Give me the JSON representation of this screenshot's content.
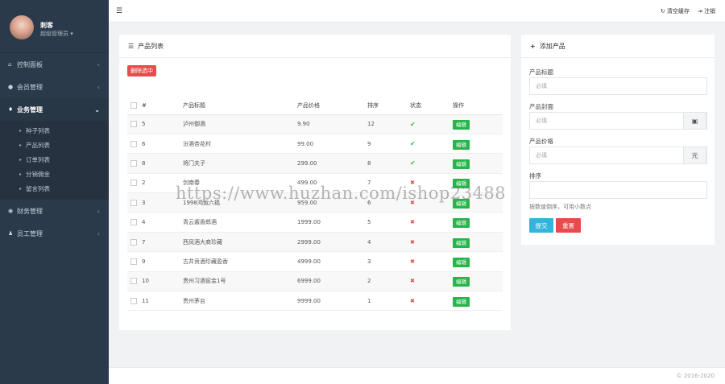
{
  "sidebar": {
    "user_name": "刺客",
    "user_role": "超级管理员",
    "menu": [
      {
        "label": "控制面板",
        "icon": "home-icon",
        "active": false
      },
      {
        "label": "会员管理",
        "icon": "user-icon",
        "active": false
      },
      {
        "label": "业务管理",
        "icon": "flame-icon",
        "active": true
      },
      {
        "label": "财务管理",
        "icon": "coins-icon",
        "active": false
      },
      {
        "label": "员工管理",
        "icon": "staff-icon",
        "active": false
      }
    ],
    "submenu": [
      "种子列表",
      "产品列表",
      "订单列表",
      "分销佣金",
      "留言列表"
    ]
  },
  "topbar": {
    "clear_cache": "清空缓存",
    "logout": "注销"
  },
  "product_panel": {
    "title": "产品列表",
    "delete_selected": "删除选中",
    "columns": [
      "#",
      "产品标题",
      "产品价格",
      "排序",
      "状态",
      "操作"
    ],
    "rows": [
      {
        "id": "5",
        "title": "泸州御酒",
        "price": "9.90",
        "sort": "12",
        "status": "on"
      },
      {
        "id": "6",
        "title": "汾酒杏花村",
        "price": "99.00",
        "sort": "9",
        "status": "on"
      },
      {
        "id": "8",
        "title": "将门夫子",
        "price": "299.00",
        "sort": "8",
        "status": "on"
      },
      {
        "id": "2",
        "title": "剑南春",
        "price": "499.00",
        "sort": "7",
        "status": "off"
      },
      {
        "id": "3",
        "title": "1998鸿运六福",
        "price": "959.00",
        "sort": "6",
        "status": "off"
      },
      {
        "id": "4",
        "title": "青云酱香郎酒",
        "price": "1999.00",
        "sort": "5",
        "status": "off"
      },
      {
        "id": "7",
        "title": "西凤酒大商珍藏",
        "price": "2999.00",
        "sort": "4",
        "status": "off"
      },
      {
        "id": "9",
        "title": "古井贡酒珍藏盈香",
        "price": "4999.00",
        "sort": "3",
        "status": "off"
      },
      {
        "id": "10",
        "title": "贵州习酒窖金1号",
        "price": "6999.00",
        "sort": "2",
        "status": "off"
      },
      {
        "id": "11",
        "title": "贵州茅台",
        "price": "9999.00",
        "sort": "1",
        "status": "off"
      }
    ],
    "edit_label": "编辑"
  },
  "add_panel": {
    "title": "添加产品",
    "title_label": "产品标题",
    "title_placeholder": "必填",
    "cover_label": "产品封面",
    "cover_placeholder": "必填",
    "price_label": "产品价格",
    "price_placeholder": "必填",
    "price_unit": "元",
    "sort_label": "排序",
    "sort_hint": "按数值倒序，可用小数点",
    "submit": "提交",
    "reset": "重置"
  },
  "footer": {
    "copyright": "© 2016-2020"
  },
  "watermark": "https://www.huzhan.com/ishop23488",
  "colors": {
    "sidebar": "#2b3a4a",
    "danger": "#e64c4c",
    "success": "#27b54a",
    "info": "#35b4db"
  }
}
